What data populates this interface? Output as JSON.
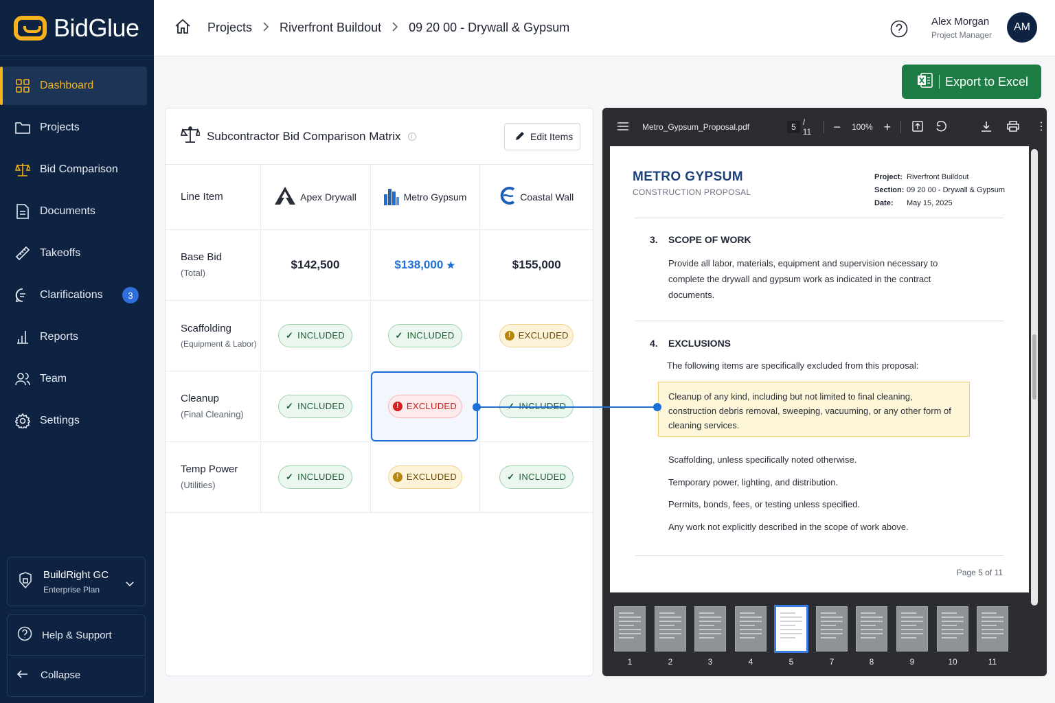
{
  "brand": {
    "name": "BidGlue",
    "accent": "#f5b21a",
    "sidebar_bg": "#0e2342"
  },
  "sidebar": {
    "items": [
      {
        "label": "Dashboard",
        "icon": "grid-icon",
        "active": true
      },
      {
        "label": "Projects",
        "icon": "folder-icon"
      },
      {
        "label": "Bid Comparison",
        "icon": "scale-icon"
      },
      {
        "label": "Documents",
        "icon": "document-icon"
      },
      {
        "label": "Takeoffs",
        "icon": "ruler-icon"
      },
      {
        "label": "Clarifications",
        "icon": "chat-icon",
        "badge": "3"
      },
      {
        "label": "Reports",
        "icon": "bar-chart-icon"
      },
      {
        "label": "Team",
        "icon": "team-icon"
      },
      {
        "label": "Settings",
        "icon": "gear-icon"
      }
    ],
    "org": {
      "name": "BuildRight GC",
      "plan": "Enterprise Plan"
    },
    "help": "Help & Support",
    "collapse": "Collapse"
  },
  "header": {
    "breadcrumb": [
      "Projects",
      "Riverfront Buildout",
      "09 20 00 - Drywall & Gypsum"
    ],
    "user": {
      "name": "Alex Morgan",
      "role": "Project Manager",
      "initials": "AM"
    }
  },
  "export": {
    "label": "Export to Excel",
    "color": "#1c7c44"
  },
  "matrix": {
    "title": "Subcontractor Bid Comparison Matrix",
    "edit_label": "Edit Items",
    "col_header": "Line Item",
    "bidders": [
      "Apex Drywall",
      "Metro Gypsum",
      "Coastal Wall"
    ],
    "rows": [
      {
        "name": "Base Bid",
        "sub": "(Total)",
        "cells": [
          "$142,500",
          "$138,000",
          "$155,000"
        ]
      },
      {
        "name": "Scaffolding",
        "sub": "(Equipment & Labor)",
        "cells": [
          "INCLUDED",
          "INCLUDED",
          "EXCLUDED"
        ]
      },
      {
        "name": "Cleanup",
        "sub": "(Final Cleaning)",
        "cells": [
          "INCLUDED",
          "EXCLUDED",
          "INCLUDED"
        ]
      },
      {
        "name": "Temp Power",
        "sub": "(Utilities)",
        "cells": [
          "INCLUDED",
          "EXCLUDED",
          "INCLUDED"
        ]
      }
    ],
    "best_marker": "★"
  },
  "viewer": {
    "file": "Metro_Gypsum_Proposal.pdf",
    "page": "5",
    "total": "/ 11",
    "zoom": "100%",
    "doc": {
      "title": "METRO GYPSUM",
      "subtitle": "CONSTRUCTION PROPOSAL",
      "project_label": "Project:",
      "project": "Riverfront Buildout",
      "section_label": "Section:",
      "section": "09 20 00 - Drywall & Gypsum",
      "date_label": "Date:",
      "date": "May 15, 2025",
      "s3_num": "3.",
      "s3_title": "SCOPE OF WORK",
      "s3_text": "Provide all labor, materials, equipment and supervision necessary to complete the drywall and gypsum work as indicated in the contract documents.",
      "s4_num": "4.",
      "s4_title": "EXCLUSIONS",
      "s4_intro": "The following items are specifically excluded from this proposal:",
      "highlight": "Cleanup of any kind, including but not limited to final cleaning, construction debris removal, sweeping, vacuuming, or any other form of cleaning services.",
      "ex1": "Scaffolding, unless specifically noted otherwise.",
      "ex2": "Temporary power, lighting, and distribution.",
      "ex3": "Permits, bonds, fees, or testing unless specified.",
      "ex4": "Any work not explicitly described in the scope of work above.",
      "page_label": "Page 5 of 11"
    },
    "thumbs": [
      "1",
      "2",
      "3",
      "4",
      "5",
      "7",
      "8",
      "9",
      "10",
      "11"
    ]
  }
}
